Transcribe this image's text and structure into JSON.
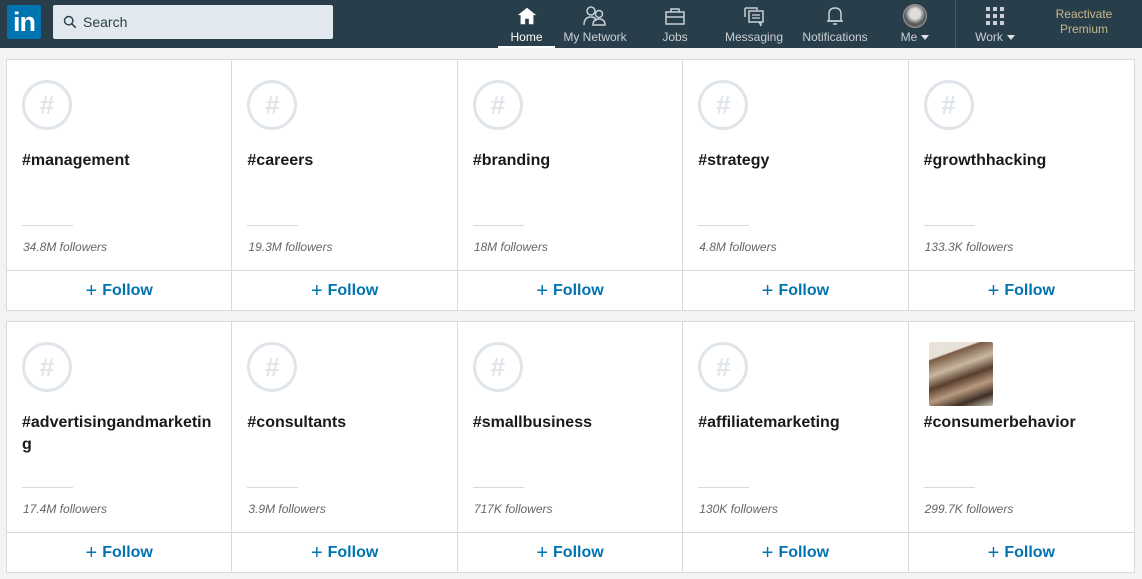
{
  "nav": {
    "logo": "in",
    "search_placeholder": "Search",
    "items": [
      {
        "label": "Home",
        "icon": "home-icon",
        "active": true
      },
      {
        "label": "My Network",
        "icon": "network-icon"
      },
      {
        "label": "Jobs",
        "icon": "briefcase-icon"
      },
      {
        "label": "Messaging",
        "icon": "messaging-icon"
      },
      {
        "label": "Notifications",
        "icon": "bell-icon"
      },
      {
        "label": "Me",
        "icon": "avatar"
      },
      {
        "label": "Work",
        "icon": "grid-icon"
      }
    ],
    "premium_line1": "Reactivate",
    "premium_line2": "Premium"
  },
  "follow_label": "Follow",
  "hashtags": [
    {
      "tag": "#management",
      "followers": "34.8M followers"
    },
    {
      "tag": "#careers",
      "followers": "19.3M followers"
    },
    {
      "tag": "#branding",
      "followers": "18M followers"
    },
    {
      "tag": "#strategy",
      "followers": "4.8M followers"
    },
    {
      "tag": "#growthhacking",
      "followers": "133.3K followers"
    },
    {
      "tag": "#advertisingandmarketing",
      "followers": "17.4M followers"
    },
    {
      "tag": "#consultants",
      "followers": "3.9M followers"
    },
    {
      "tag": "#smallbusiness",
      "followers": "717K followers"
    },
    {
      "tag": "#affiliatemarketing",
      "followers": "130K followers"
    },
    {
      "tag": "#consumerbehavior",
      "followers": "299.7K followers",
      "image": true
    }
  ]
}
